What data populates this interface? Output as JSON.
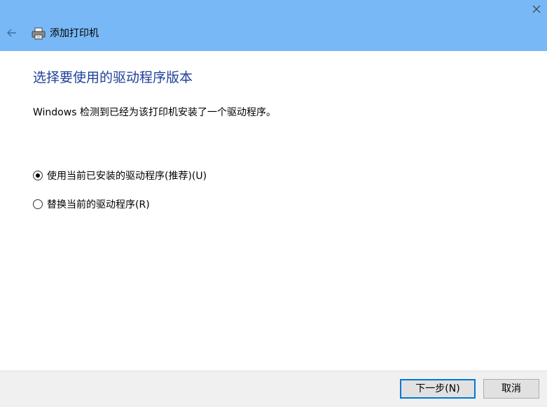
{
  "window": {
    "title": "添加打印机",
    "close_glyph": "✕",
    "back_glyph": "←",
    "titlebar_color": "#78b8f6"
  },
  "main": {
    "heading": "选择要使用的驱动程序版本",
    "description": "Windows 检测到已经为该打印机安装了一个驱动程序。",
    "options": [
      {
        "label": "使用当前已安装的驱动程序(推荐)(U)",
        "selected": true
      },
      {
        "label": "替换当前的驱动程序(R)",
        "selected": false
      }
    ]
  },
  "footer": {
    "next_label": "下一步(N)",
    "cancel_label": "取消"
  },
  "icons": {
    "back": "arrow-left-icon",
    "printer": "printer-icon",
    "close": "close-icon"
  },
  "colors": {
    "heading": "#1f3f9a",
    "accent": "#0078d7"
  }
}
